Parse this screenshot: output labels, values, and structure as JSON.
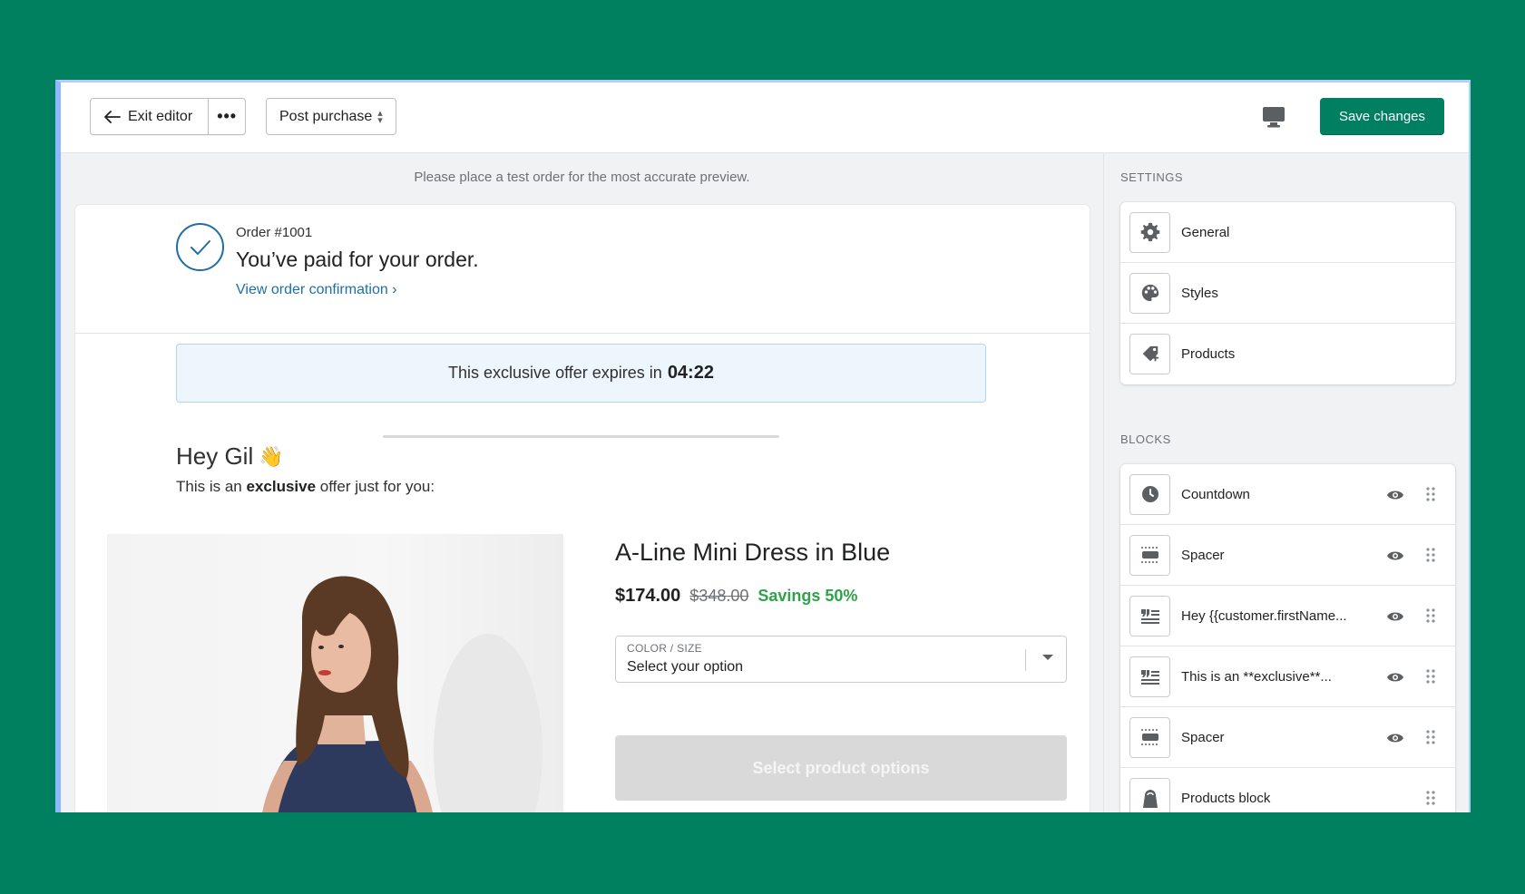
{
  "colors": {
    "background": "#00805f",
    "primary_button": "#008060",
    "link": "#1f6fa3",
    "savings": "#2fa24a"
  },
  "toolbar": {
    "exit_label": "Exit editor",
    "more_label": "•••",
    "page_select": "Post purchase",
    "save_label": "Save changes",
    "preview_device_icon": "desktop-icon"
  },
  "preview": {
    "notice": "Please place a test order for the most accurate preview.",
    "order": {
      "number": "Order #1001",
      "title": "You’ve paid for your order.",
      "link": "View order confirmation ›"
    },
    "offer": {
      "text": "This exclusive offer expires in",
      "timer": "04:22"
    },
    "greeting": "Hey Gil",
    "greeting_emoji": "👋",
    "sub_prefix": "This is an",
    "sub_bold": "exclusive",
    "sub_suffix": "offer just for you:",
    "product": {
      "name": "A-Line Mini Dress in Blue",
      "price": "$174.00",
      "compare_price": "$348.00",
      "savings": "Savings 50%",
      "variant_label": "COLOR / SIZE",
      "variant_value": "Select your option",
      "cta": "Select product options"
    }
  },
  "sidebar": {
    "settings_title": "SETTINGS",
    "settings": [
      {
        "label": "General",
        "icon": "gear-icon"
      },
      {
        "label": "Styles",
        "icon": "palette-icon"
      },
      {
        "label": "Products",
        "icon": "tag-add-icon"
      }
    ],
    "blocks_title": "BLOCKS",
    "blocks": [
      {
        "label": "Countdown",
        "icon": "clock-icon"
      },
      {
        "label": "Spacer",
        "icon": "spacer-icon"
      },
      {
        "label": "Hey {{customer.firstName...",
        "icon": "text-quote-icon"
      },
      {
        "label": "This is an **exclusive**...",
        "icon": "text-quote-icon"
      },
      {
        "label": "Spacer",
        "icon": "spacer-icon"
      },
      {
        "label": "Products block",
        "icon": "shopping-bag-icon"
      }
    ]
  }
}
